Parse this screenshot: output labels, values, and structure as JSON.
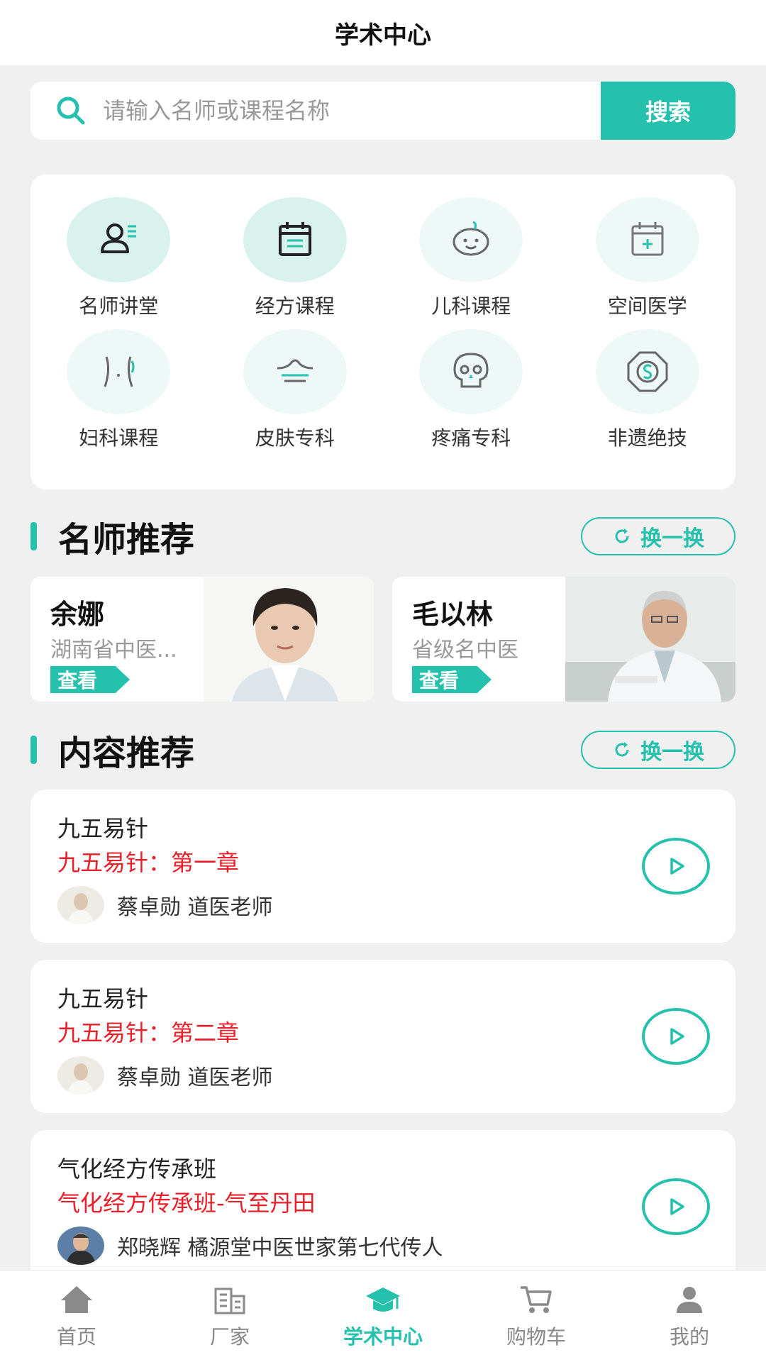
{
  "header": {
    "title": "学术中心"
  },
  "search": {
    "placeholder": "请输入名师或课程名称",
    "button": "搜索"
  },
  "categories": [
    {
      "label": "名师讲堂",
      "icon": "teacher-icon"
    },
    {
      "label": "经方课程",
      "icon": "calendar-list-icon"
    },
    {
      "label": "儿科课程",
      "icon": "baby-face-icon"
    },
    {
      "label": "空间医学",
      "icon": "calendar-plus-icon"
    },
    {
      "label": "妇科课程",
      "icon": "female-body-icon"
    },
    {
      "label": "皮肤专科",
      "icon": "skin-layer-icon"
    },
    {
      "label": "疼痛专科",
      "icon": "skull-icon"
    },
    {
      "label": "非遗绝技",
      "icon": "octagon-coin-icon"
    }
  ],
  "teacher_section": {
    "title": "名师推荐",
    "refresh": "换一换"
  },
  "teachers": [
    {
      "name": "余娜",
      "title": "湖南省中医...",
      "view": "查看"
    },
    {
      "name": "毛以林",
      "title": "省级名中医",
      "view": "查看"
    }
  ],
  "content_section": {
    "title": "内容推荐",
    "refresh": "换一换"
  },
  "contents": [
    {
      "title": "九五易针",
      "chapter": "九五易针：第一章",
      "author": "蔡卓勋 道医老师"
    },
    {
      "title": "九五易针",
      "chapter": "九五易针：第二章",
      "author": "蔡卓勋 道医老师"
    },
    {
      "title": "气化经方传承班",
      "chapter": "气化经方传承班-气至丹田",
      "author": "郑晓辉 橘源堂中医世家第七代传人"
    }
  ],
  "tabs": [
    {
      "label": "首页",
      "icon": "home-icon"
    },
    {
      "label": "厂家",
      "icon": "building-icon"
    },
    {
      "label": "学术中心",
      "icon": "graduation-cap-icon",
      "active": true
    },
    {
      "label": "购物车",
      "icon": "cart-icon"
    },
    {
      "label": "我的",
      "icon": "user-icon"
    }
  ],
  "colors": {
    "accent": "#25c1ad",
    "chapter": "#e8202a"
  }
}
